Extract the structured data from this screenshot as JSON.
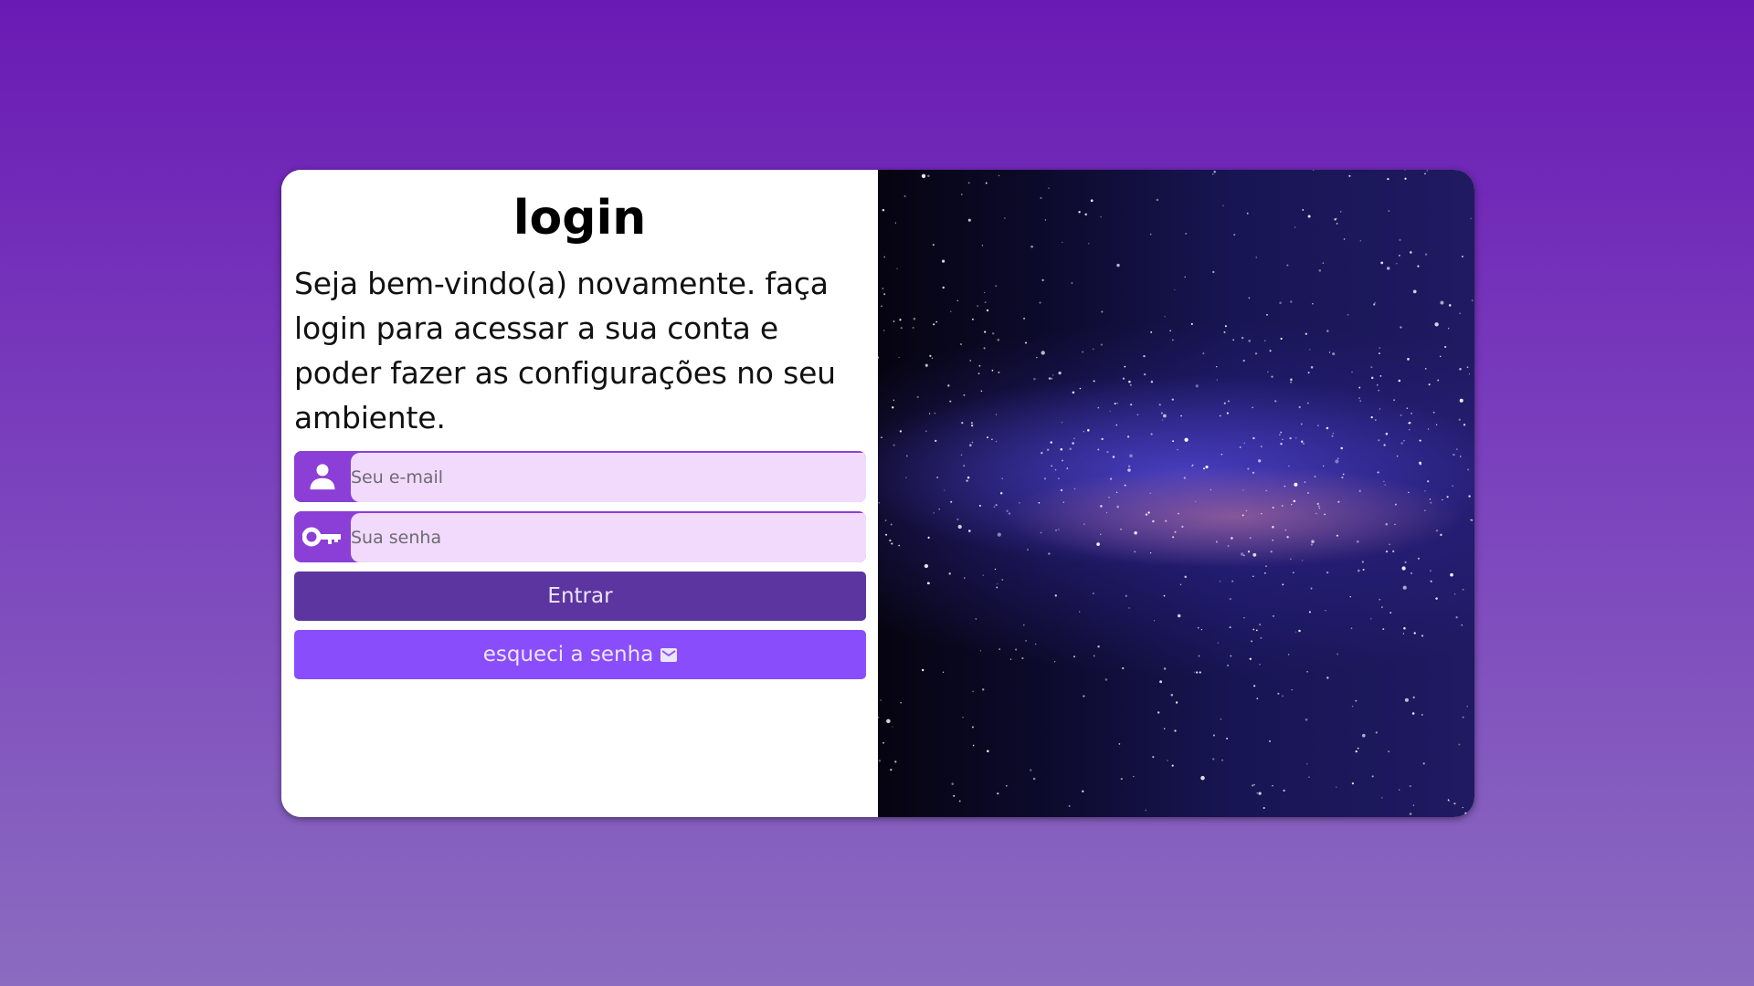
{
  "login": {
    "title": "login",
    "description": "Seja bem-vindo(a) novamente. faça login para acessar a sua conta e poder fazer as configurações no seu ambiente.",
    "email": {
      "placeholder": "Seu e-mail",
      "value": "",
      "icon": "user-icon"
    },
    "password": {
      "placeholder": "Sua senha",
      "value": "",
      "icon": "key-icon"
    },
    "submit_label": "Entrar",
    "forgot_label": "esqueci a senha",
    "forgot_icon": "mail-icon"
  },
  "hero_image": {
    "subject": "starry-night-sky",
    "icon": "galaxy-image"
  },
  "colors": {
    "primary_button": "#5c35a0",
    "secondary_button": "#8a4dfc",
    "icon_background": "#8b3fd6",
    "input_background": "#f1dafc"
  }
}
